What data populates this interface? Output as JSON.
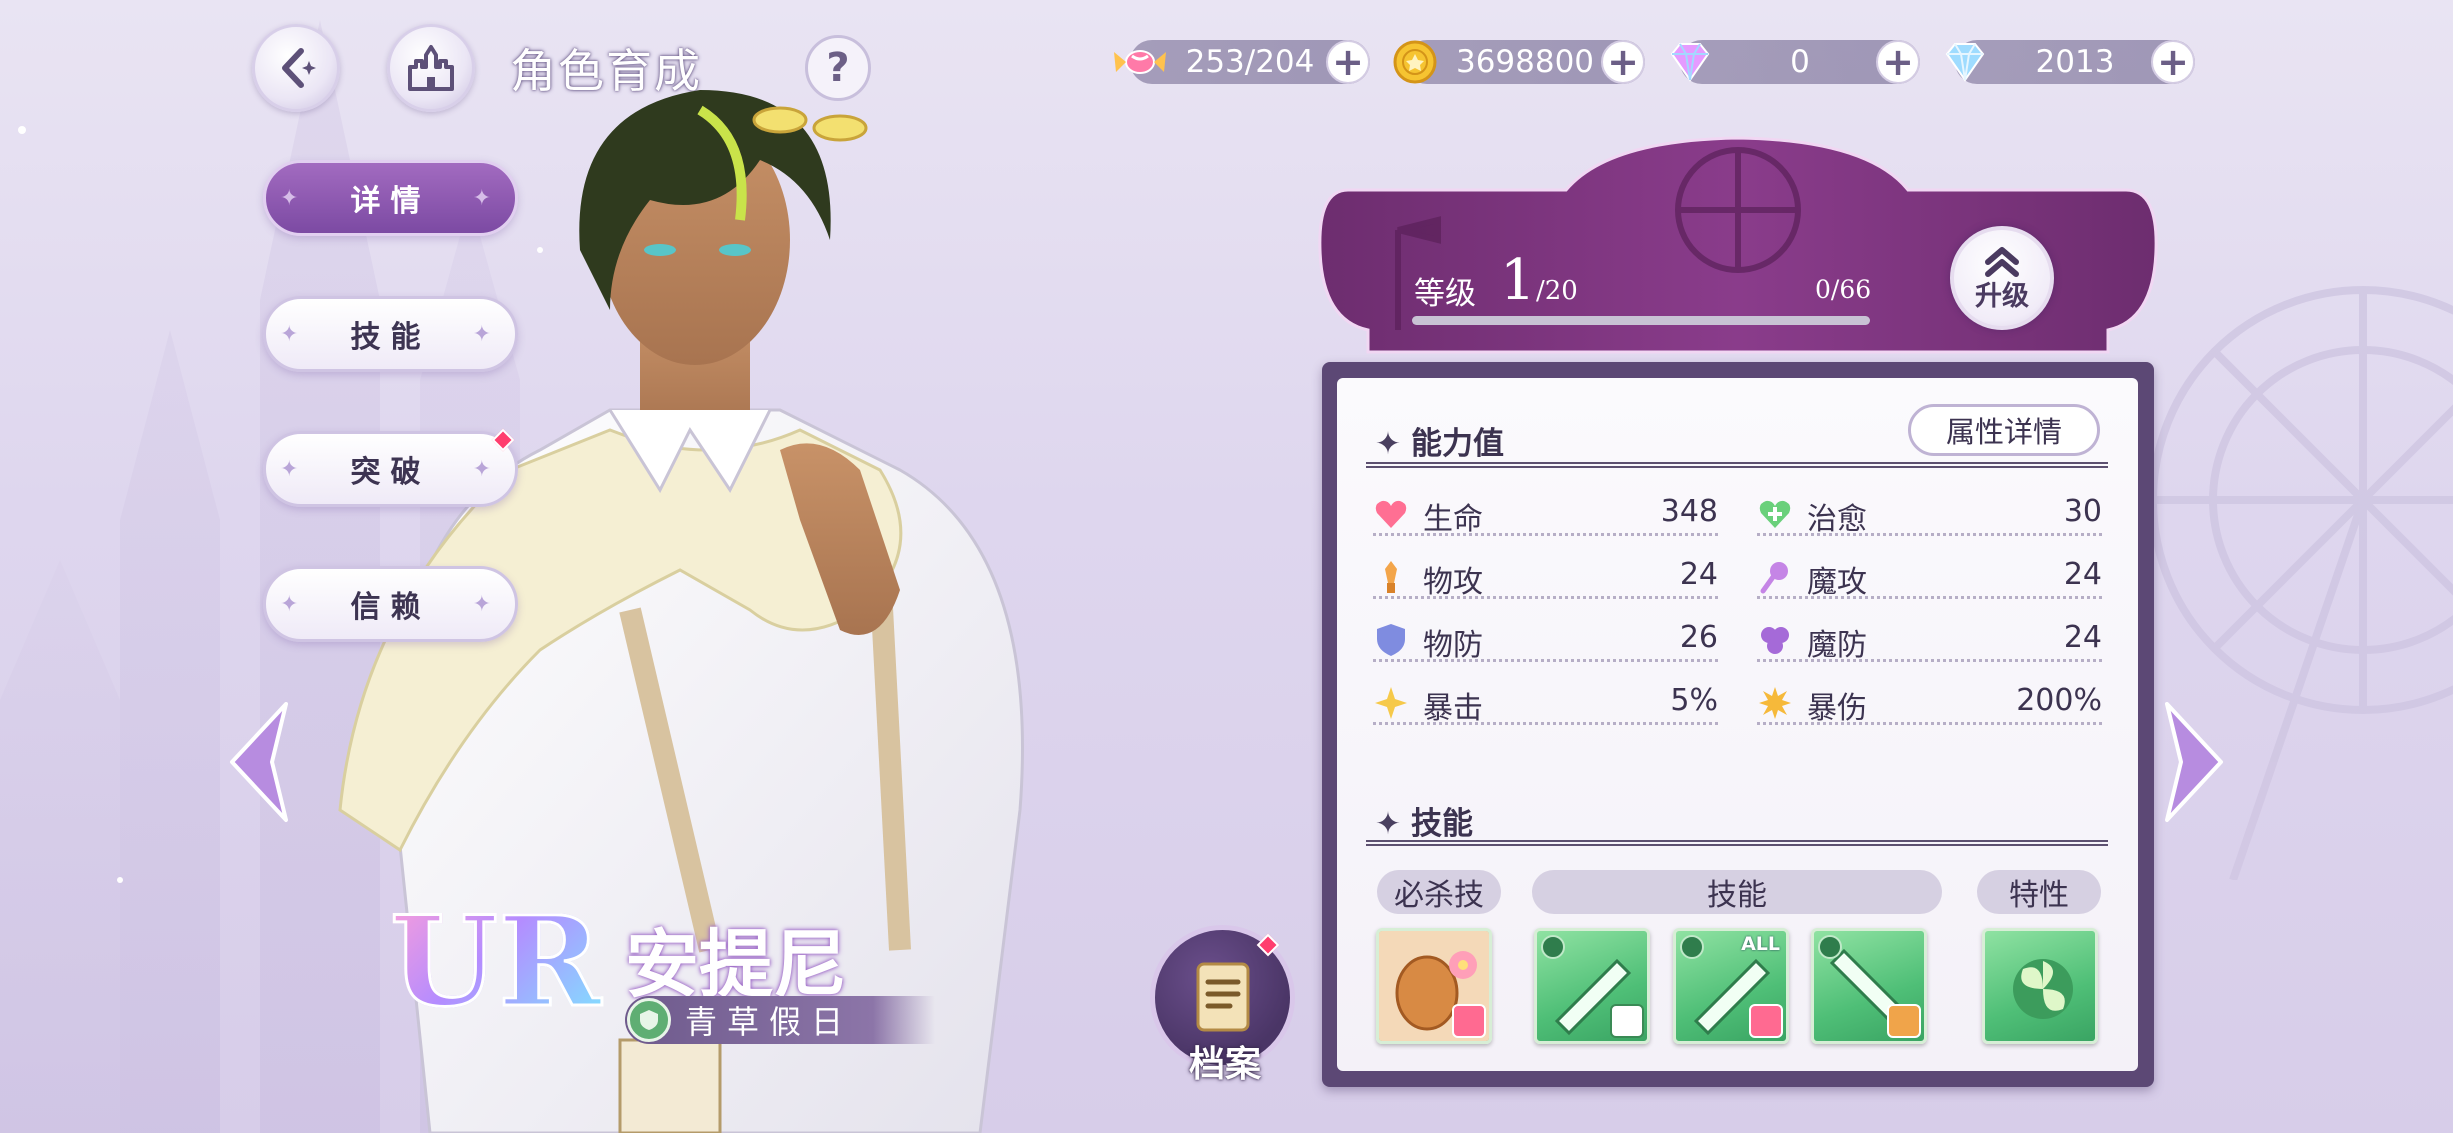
{
  "header": {
    "title": "角色育成",
    "help_label": "?"
  },
  "resources": [
    {
      "icon": "candy-icon",
      "value": "253/204"
    },
    {
      "icon": "gold-coin-icon",
      "value": "3698800"
    },
    {
      "icon": "pink-gem-icon",
      "value": "0"
    },
    {
      "icon": "diamond-icon",
      "value": "2013"
    }
  ],
  "nav": {
    "details": "详情",
    "skills": "技能",
    "breakthrough": "突破",
    "trust": "信赖"
  },
  "character": {
    "rarity": "UR",
    "name": "安提尼",
    "outfit": "青草假日"
  },
  "archive_label": "档案",
  "level": {
    "label": "等级",
    "current": "1",
    "max": "/20",
    "exp_text": "0/66",
    "exp_progress": 0,
    "upgrade_label": "升级"
  },
  "stats": {
    "section_title": "能力值",
    "detail_button": "属性详情",
    "items": [
      {
        "name": "生命",
        "value": "348",
        "icon": "heart-icon",
        "color": "#ff6f93"
      },
      {
        "name": "治愈",
        "value": "30",
        "icon": "heal-icon",
        "color": "#6ad07b"
      },
      {
        "name": "物攻",
        "value": "24",
        "icon": "sword-icon",
        "color": "#f3a54a"
      },
      {
        "name": "魔攻",
        "value": "24",
        "icon": "wand-icon",
        "color": "#c585e6"
      },
      {
        "name": "物防",
        "value": "26",
        "icon": "shield-icon",
        "color": "#7f8ce0"
      },
      {
        "name": "魔防",
        "value": "24",
        "icon": "magic-defense-icon",
        "color": "#a56ad8"
      },
      {
        "name": "暴击",
        "value": "5%",
        "icon": "crit-star-icon",
        "color": "#f6c94a"
      },
      {
        "name": "暴伤",
        "value": "200%",
        "icon": "crit-damage-icon",
        "color": "#f6b93a"
      }
    ]
  },
  "skills": {
    "section_title": "技能",
    "ultimate_label": "必杀技",
    "skills_label": "技能",
    "trait_label": "特性",
    "all_tag": "ALL"
  },
  "colors": {
    "accent_purple": "#7c4aa3",
    "panel_frame": "#5c4875",
    "badge_red": "#ff3d6e"
  }
}
